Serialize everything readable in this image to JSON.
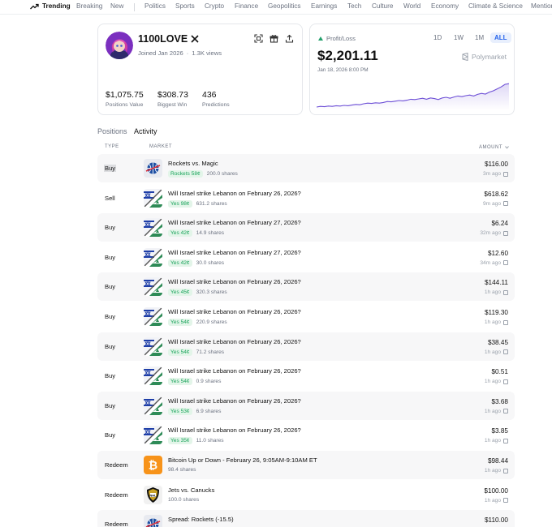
{
  "nav": {
    "trending": "Trending",
    "items": [
      "Breaking",
      "New",
      "Politics",
      "Sports",
      "Crypto",
      "Finance",
      "Geopolitics",
      "Earnings",
      "Tech",
      "Culture",
      "World",
      "Economy",
      "Climate & Science",
      "Mention"
    ]
  },
  "profile": {
    "name": "1100LOVE",
    "joined": "Joined Jan 2026",
    "views": "1.3K views",
    "positions_value": "$1,075.75",
    "positions_value_label": "Positions Value",
    "biggest_win": "$308.73",
    "biggest_win_label": "Biggest Win",
    "predictions": "436",
    "predictions_label": "Predictions"
  },
  "pnl": {
    "label": "Profit/Loss",
    "ranges": [
      "1D",
      "1W",
      "1M",
      "ALL"
    ],
    "active_range": "ALL",
    "value": "$2,201.11",
    "date": "Jan 18, 2026 8:00 PM",
    "brand": "Polymarket",
    "accent_color": "#6d4fd6",
    "series": [
      0.1,
      0.12,
      0.11,
      0.13,
      0.12,
      0.14,
      0.13,
      0.15,
      0.14,
      0.16,
      0.18,
      0.17,
      0.2,
      0.22,
      0.21,
      0.23,
      0.22,
      0.24,
      0.27,
      0.26,
      0.28,
      0.3,
      0.29,
      0.31,
      0.34,
      0.33,
      0.35,
      0.37,
      0.34,
      0.38,
      0.36,
      0.33,
      0.38,
      0.4,
      0.37,
      0.41,
      0.44,
      0.42,
      0.45,
      0.47,
      0.44,
      0.49,
      0.52,
      0.5,
      0.56,
      0.6,
      0.66,
      0.72,
      0.8,
      0.82
    ]
  },
  "tabs": {
    "positions": "Positions",
    "activity": "Activity"
  },
  "table": {
    "headers": {
      "type": "TYPE",
      "market": "MARKET",
      "amount": "AMOUNT"
    },
    "rows": [
      {
        "type": "Buy",
        "title": "Rockets vs. Magic",
        "outcome": "Rockets 58¢",
        "shares": "200.0 shares",
        "amount": "$116.00",
        "ago": "3m ago",
        "thumb": "basketball"
      },
      {
        "type": "Sell",
        "title": "Will Israel strike Lebanon on February 26, 2026?",
        "outcome": "Yes 98¢",
        "shares": "631.2 shares",
        "amount": "$618.62",
        "ago": "9m ago",
        "thumb": "flags"
      },
      {
        "type": "Buy",
        "title": "Will Israel strike Lebanon on February 27, 2026?",
        "outcome": "Yes 42¢",
        "shares": "14.9 shares",
        "amount": "$6.24",
        "ago": "32m ago",
        "thumb": "flags"
      },
      {
        "type": "Buy",
        "title": "Will Israel strike Lebanon on February 27, 2026?",
        "outcome": "Yes 42¢",
        "shares": "30.0 shares",
        "amount": "$12.60",
        "ago": "34m ago",
        "thumb": "flags"
      },
      {
        "type": "Buy",
        "title": "Will Israel strike Lebanon on February 26, 2026?",
        "outcome": "Yes 45¢",
        "shares": "320.3 shares",
        "amount": "$144.11",
        "ago": "1h ago",
        "thumb": "flags"
      },
      {
        "type": "Buy",
        "title": "Will Israel strike Lebanon on February 26, 2026?",
        "outcome": "Yes 54¢",
        "shares": "220.9 shares",
        "amount": "$119.30",
        "ago": "1h ago",
        "thumb": "flags"
      },
      {
        "type": "Buy",
        "title": "Will Israel strike Lebanon on February 26, 2026?",
        "outcome": "Yes 54¢",
        "shares": "71.2 shares",
        "amount": "$38.45",
        "ago": "1h ago",
        "thumb": "flags"
      },
      {
        "type": "Buy",
        "title": "Will Israel strike Lebanon on February 26, 2026?",
        "outcome": "Yes 54¢",
        "shares": "0.9 shares",
        "amount": "$0.51",
        "ago": "1h ago",
        "thumb": "flags"
      },
      {
        "type": "Buy",
        "title": "Will Israel strike Lebanon on February 26, 2026?",
        "outcome": "Yes 53¢",
        "shares": "6.9 shares",
        "amount": "$3.68",
        "ago": "1h ago",
        "thumb": "flags"
      },
      {
        "type": "Buy",
        "title": "Will Israel strike Lebanon on February 26, 2026?",
        "outcome": "Yes 35¢",
        "shares": "11.0 shares",
        "amount": "$3.85",
        "ago": "1h ago",
        "thumb": "flags"
      },
      {
        "type": "Redeem",
        "title": "Bitcoin Up or Down - February 26, 9:05AM-9:10AM ET",
        "outcome": "",
        "shares": "98.4 shares",
        "amount": "$98.44",
        "ago": "1h ago",
        "thumb": "bitcoin"
      },
      {
        "type": "Redeem",
        "title": "Jets vs. Canucks",
        "outcome": "",
        "shares": "100.0 shares",
        "amount": "$100.00",
        "ago": "1h ago",
        "thumb": "nhl"
      },
      {
        "type": "Redeem",
        "title": "Spread: Rockets (-15.5)",
        "outcome": "",
        "shares": "",
        "amount": "$110.00",
        "ago": "",
        "thumb": "basketball"
      }
    ]
  }
}
